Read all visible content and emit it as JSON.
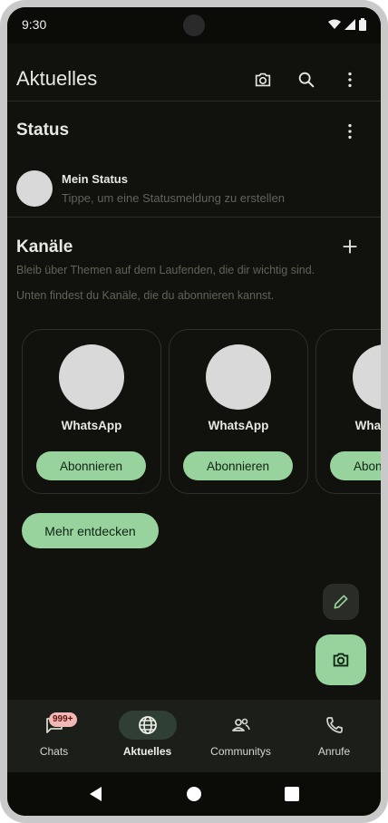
{
  "status_bar": {
    "time": "9:30"
  },
  "appbar": {
    "title": "Aktuelles",
    "icons": [
      "camera-icon",
      "search-icon",
      "more-vert-icon"
    ]
  },
  "status_section": {
    "title": "Status",
    "my_status": {
      "name": "Mein Status",
      "hint": "Tippe, um eine Statusmeldung zu erstellen"
    }
  },
  "channels_section": {
    "title": "Kanäle",
    "description_line1": "Bleib über Themen auf dem Laufenden, die dir wichtig sind.",
    "description_line2": "Unten findest du Kanäle, die du abonnieren kannst.",
    "cards": [
      {
        "name": "WhatsApp",
        "button": "Abonnieren"
      },
      {
        "name": "WhatsApp",
        "button": "Abonnieren"
      },
      {
        "name": "WhatsApp",
        "button": "Abonnieren"
      }
    ],
    "discover_button": "Mehr entdecken"
  },
  "bottom_nav": {
    "items": [
      {
        "label": "Chats",
        "icon": "chat-icon",
        "badge": "999+",
        "active": false
      },
      {
        "label": "Aktuelles",
        "icon": "globe-icon",
        "active": true
      },
      {
        "label": "Communitys",
        "icon": "people-icon",
        "active": false
      },
      {
        "label": "Anrufe",
        "icon": "phone-icon",
        "active": false
      }
    ]
  },
  "colors": {
    "background": "#11120d",
    "accent": "#98d39e",
    "text": "#e8e8e2",
    "muted_text": "#5f6358",
    "badge": "#f2b8b5"
  }
}
